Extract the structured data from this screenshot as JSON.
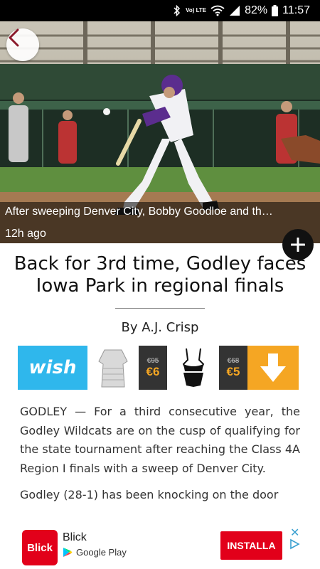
{
  "status_bar": {
    "network": "Vo) LTE",
    "battery": "82%",
    "time": "11:57"
  },
  "hero": {
    "caption": "After sweeping Denver City, Bobby Goodloe and th…",
    "time_ago": "12h ago"
  },
  "article": {
    "headline": "Back for 3rd time, Godley faces Iowa Park in regional finals",
    "byline": "By A.J. Crisp",
    "paragraphs": [
      "GODLEY — For a third consecutive year, the Godley Wildcats are on the cusp of qualifying for the state tournament after reaching the Class 4A Region I finals with a sweep of Denver City.",
      "Godley (28-1) has been knocking on the door"
    ]
  },
  "ad_banner": {
    "brand": "wish",
    "items": [
      {
        "old_price": "€95",
        "new_price": "€6"
      },
      {
        "old_price": "€68",
        "new_price": "€5"
      }
    ]
  },
  "bottom_ad": {
    "logo_text": "Blick",
    "app_name": "Blick",
    "store": "Google Play",
    "install_label": "INSTALLA",
    "close_symbol": "✕"
  },
  "icons": [
    "bluetooth-icon",
    "wifi-icon",
    "signal-icon",
    "battery-icon",
    "back-chevron-icon",
    "plus-icon",
    "download-arrow-icon",
    "google-play-icon",
    "adchoices-icon"
  ],
  "colors": {
    "accent_red": "#e2001a",
    "wish_blue": "#2fb7ec",
    "download_orange": "#f5a623",
    "back_chevron": "#8b1a2b"
  }
}
